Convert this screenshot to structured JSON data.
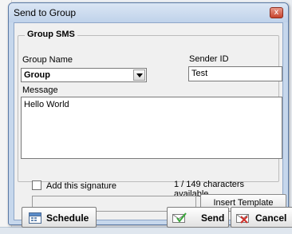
{
  "window": {
    "title": "Send to Group",
    "close_glyph": "x"
  },
  "group_sms": {
    "legend": "Group SMS",
    "group_name_label": "Group Name",
    "group_name_value": "Group",
    "sender_id_label": "Sender ID",
    "sender_id_value": "Test",
    "message_label": "Message",
    "message_value": "Hello World"
  },
  "signature": {
    "checkbox_label": "Add this signature",
    "checked": false,
    "char_counter": "1 / 149 characters available.",
    "insert_template_label": "Insert Template"
  },
  "footer": {
    "schedule_label": "Schedule",
    "send_label": "Send",
    "cancel_label": "Cancel"
  },
  "colors": {
    "titlebar": "#c6d7ec",
    "close_button": "#c7432c",
    "send_icon": "#3aa83a",
    "cancel_icon": "#d0302a"
  },
  "icons": {
    "schedule": "calendar-icon",
    "send": "envelope-check-icon",
    "cancel": "envelope-x-icon",
    "close": "close-icon",
    "dropdown": "chevron-down-icon"
  }
}
